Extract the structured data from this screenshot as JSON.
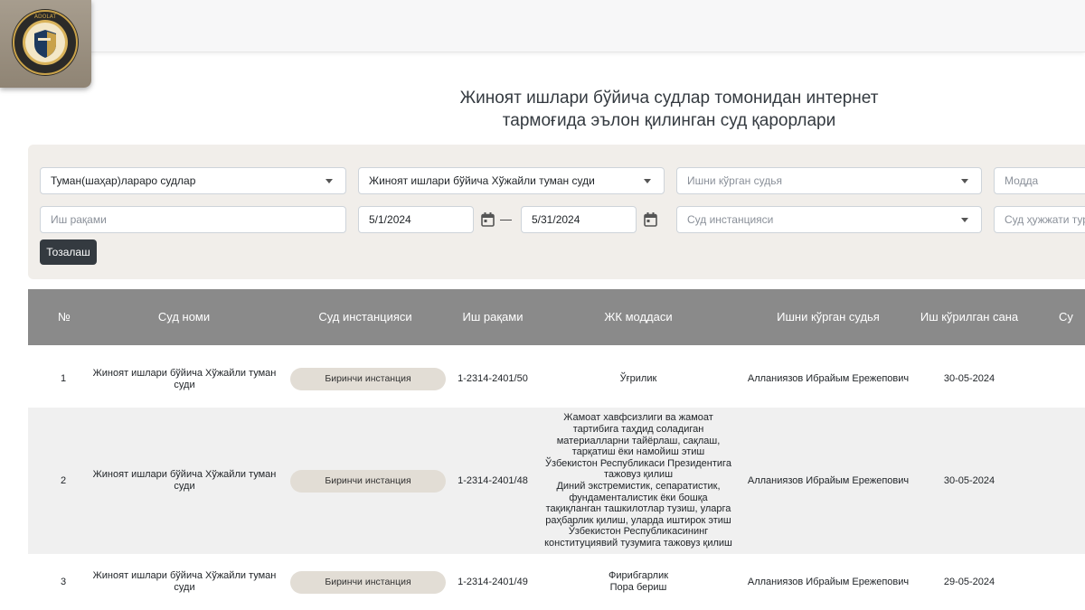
{
  "header": {
    "title_line1": "Жиноят ишлари бўйича судлар томонидан интернет",
    "title_line2": "тармоғида эълон қилинган суд қарорлари"
  },
  "filters": {
    "court_level": "Туман(шаҳар)лараро судлар",
    "court": "Жиноят ишлари бўйича Хўжайли туман суди",
    "judge_placeholder": "Ишни кўрган судья",
    "article_placeholder": "Модда",
    "case_number_placeholder": "Иш рақами",
    "date_from": "5/1/2024",
    "date_separator": "—",
    "date_to": "5/31/2024",
    "instance_placeholder": "Суд инстанцияси",
    "document_type_placeholder": "Суд ҳужжати тури",
    "clear_label": "Тозалаш"
  },
  "table": {
    "columns": [
      "№",
      "Суд номи",
      "Суд инстанцияси",
      "Иш рақами",
      "ЖК моддаси",
      "Ишни кўрган судья",
      "Иш кўрилган сана",
      "Су"
    ],
    "rows": [
      {
        "num": "1",
        "court": "Жиноят ишлари бўйича Хўжайли туман суди",
        "instance": "Биринчи инстанция",
        "case_number": "1-2314-2401/50",
        "article": "Ўғрилик",
        "judge": "Алланиязов Ибрайым Ережепович",
        "date": "30-05-2024"
      },
      {
        "num": "2",
        "court": "Жиноят ишлари бўйича Хўжайли туман суди",
        "instance": "Биринчи инстанция",
        "case_number": "1-2314-2401/48",
        "article": "Жамоат хавфсизлиги ва жамоат тартибига таҳдид соладиган материалларни тайёрлаш, сақлаш, тарқатиш ёки намойиш этиш\nЎзбекистон Республикаси Президентига тажовуз қилиш\nДиний экстремистик, сепаратистик, фундаменталистик ёки бошқа тақиқланган ташкилотлар тузиш, уларга раҳбарлик қилиш, уларда иштирок этиш\nЎзбекистон Республикасининг конституциявий тузумига тажовуз қилиш",
        "judge": "Алланиязов Ибрайым Ережепович",
        "date": "30-05-2024"
      },
      {
        "num": "3",
        "court": "Жиноят ишлари бўйича Хўжайли туман суди",
        "instance": "Биринчи инстанция",
        "case_number": "1-2314-2401/49",
        "article": "Фирибгарлик\nПора бериш",
        "judge": "Алланиязов Ибрайым Ережепович",
        "date": "29-05-2024"
      }
    ]
  },
  "icons": {
    "logo": "adolat-emblem-icon",
    "calendar": "calendar-icon",
    "dropdown": "chevron-down-icon"
  },
  "logo_text": "ADOLAT",
  "colors": {
    "table_header": "#8a8a8a",
    "filter_panel": "#f1eeea",
    "badge": "#e2ddd5",
    "button": "#343a40"
  }
}
